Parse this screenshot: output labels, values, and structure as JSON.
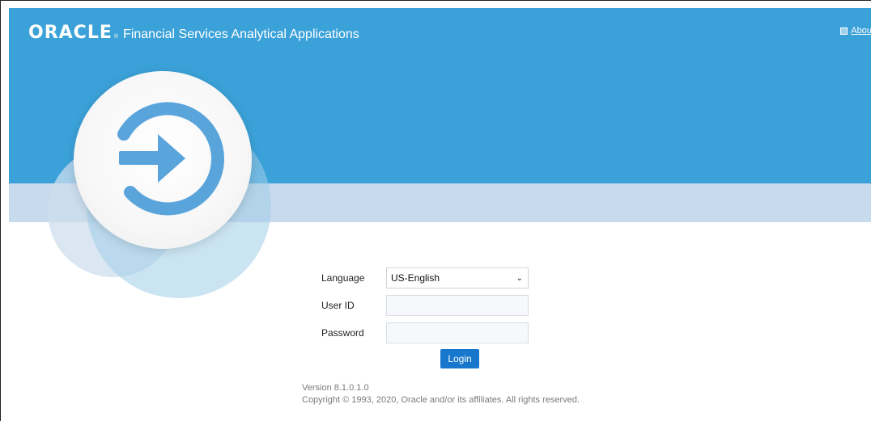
{
  "header": {
    "brand": "ORACLE",
    "brand_mark": "®",
    "title": "Financial Services Analytical Applications",
    "about_label": "Abou"
  },
  "form": {
    "language_label": "Language",
    "language_value": "US-English",
    "userid_label": "User ID",
    "userid_value": "",
    "password_label": "Password",
    "password_value": "",
    "login_label": "Login"
  },
  "footer": {
    "version": "Version 8.1.0.1.0",
    "copyright": "Copyright © 1993, 2020, Oracle and/or its affiliates. All rights reserved."
  },
  "colors": {
    "banner": "#3ba2d9",
    "band": "#c8daee",
    "login_button": "#1677cc"
  },
  "icons": {
    "logo": "login-arrow-icon",
    "about": "info-square-icon",
    "dropdown": "chevron-down-icon"
  }
}
